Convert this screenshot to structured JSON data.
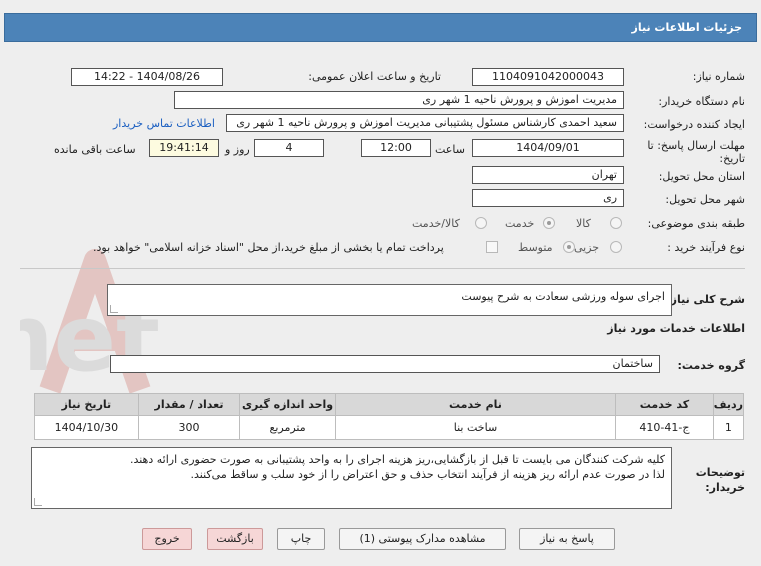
{
  "header": {
    "title": "جزئیات اطلاعات نیاز"
  },
  "fields": {
    "need_number_label": "شماره نیاز:",
    "need_number": "1104091042000043",
    "announce_label": "تاریخ و ساعت اعلان عمومی:",
    "announce_value": "1404/08/26 - 14:22",
    "buyer_label": "نام دستگاه خریدار:",
    "buyer_value": "مدیریت اموزش و پرورش ناحیه 1 شهر ری",
    "creator_label": "ایجاد کننده درخواست:",
    "creator_value": "سعید احمدی کارشناس مسئول پشتیبانی مدیریت اموزش و پرورش ناحیه 1 شهر ری",
    "contact_link": "اطلاعات تماس خریدار",
    "deadline_label_1": "مهلت ارسال پاسخ: تا",
    "deadline_label_2": "تاریخ:",
    "deadline_date": "1404/09/01",
    "time_label": "ساعت",
    "deadline_time": "12:00",
    "days_value": "4",
    "days_label": "روز و",
    "remaining_time": "19:41:14",
    "remaining_label": "ساعت باقی مانده",
    "province_label": "استان محل تحویل:",
    "province_value": "تهران",
    "city_label": "شهر محل تحویل:",
    "city_value": "ری",
    "category_label": "طبقه بندی موضوعی:",
    "category_options": [
      "کالا",
      "خدمت",
      "کالا/خدمت"
    ],
    "process_label": "نوع فرآیند خرید :",
    "process_options": [
      "جزیی",
      "متوسط"
    ],
    "payment_note": "پرداخت تمام یا بخشی از مبلغ خرید،از محل \"اسناد خزانه اسلامی\" خواهد بود."
  },
  "summary": {
    "label": "شرح کلی نیاز:",
    "value": "اجرای سوله ورزشی سعادت به شرح پیوست"
  },
  "services": {
    "section_title": "اطلاعات خدمات مورد نیاز",
    "group_label": "گروه خدمت:",
    "group_value": "ساختمان",
    "columns": [
      "ردیف",
      "کد خدمت",
      "نام خدمت",
      "واحد اندازه گیری",
      "تعداد / مقدار",
      "تاریخ نیاز"
    ],
    "rows": [
      {
        "row": "1",
        "code": "ج-41-410",
        "name": "ساخت بنا",
        "unit": "مترمربع",
        "qty": "300",
        "date": "1404/10/30"
      }
    ]
  },
  "notes": {
    "label_1": "توضیحات",
    "label_2": "خریدار:",
    "line_1": "کلیه شرکت کنندگان می بایست تا قبل از بازگشایی،ریز هزینه اجرای را به واحد پشتیبانی به صورت حضوری ارائه دهند.",
    "line_2": "لذا در صورت عدم ارائه ریز هزینه از فرآیند انتخاب حذف و حق اعتراض را از خود سلب و ساقط می‌کنند."
  },
  "buttons": {
    "reply": "پاسخ به نیاز",
    "view_docs": "مشاهده مدارک پیوستی (1)",
    "print": "چاپ",
    "back": "بازگشت",
    "exit": "خروج"
  },
  "watermark": {
    "text": "AriaTender.net"
  },
  "colors": {
    "header": "#4c83b8",
    "link": "#1b5fc1",
    "pink_button": "#f6d6d6"
  }
}
